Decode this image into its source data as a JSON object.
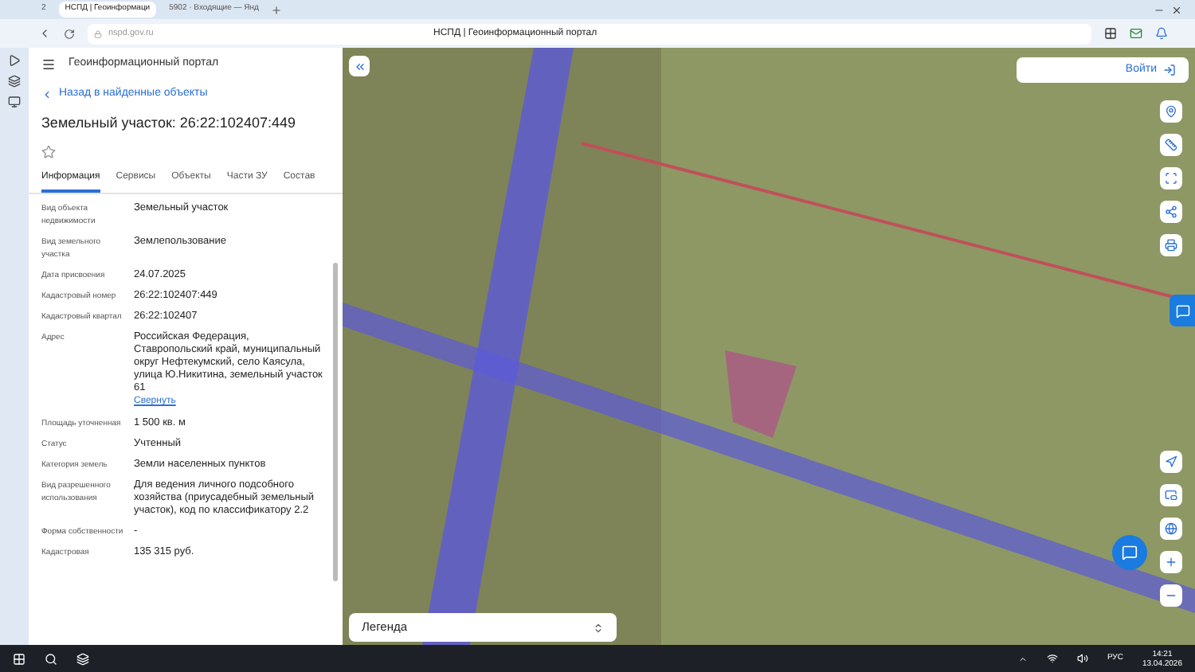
{
  "browser": {
    "tabs": [
      {
        "label": "2",
        "selected": false
      },
      {
        "label": "НСПД | Геоинформаци",
        "selected": true
      },
      {
        "label": "5902 · Входящие — Янд",
        "selected": false
      }
    ],
    "address": "nspd.gov.ru",
    "page_title": "НСПД | Геоинформационный портал"
  },
  "panel": {
    "app_title": "Геоинформационный портал",
    "back_link": "Назад в найденные объекты",
    "title": "Земельный участок: 26:22:102407:449",
    "favorite": false,
    "tabs": [
      {
        "label": "Информация",
        "selected": true
      },
      {
        "label": "Сервисы",
        "selected": false
      },
      {
        "label": "Объекты",
        "selected": false
      },
      {
        "label": "Части ЗУ",
        "selected": false
      },
      {
        "label": "Состав",
        "selected": false
      }
    ],
    "rows": [
      {
        "label": "Вид объекта недвижимости",
        "value": "Земельный участок"
      },
      {
        "label": "Вид земельного участка",
        "value": "Землепользование"
      },
      {
        "label": "Дата присвоения",
        "value": "24.07.2025"
      },
      {
        "label": "Кадастровый номер",
        "value": "26:22:102407:449"
      },
      {
        "label": "Кадастровый квартал",
        "value": "26:22:102407"
      },
      {
        "label": "Адрес",
        "value": "Российская Федерация, Ставропольский край, муниципальный округ Нефтекумский, село Каясула, улица Ю.Никитина, земельный участок 61",
        "link": "Свернуть"
      },
      {
        "label": "Площадь уточненная",
        "value": "1 500 кв. м"
      },
      {
        "label": "Статус",
        "value": "Учтенный"
      },
      {
        "label": "Категория земель",
        "value": "Земли населенных пунктов"
      },
      {
        "label": "Вид разрешенного использования",
        "value": "Для ведения личного подсобного хозяйства (приусадебный земельный участок), код по классификатору 2.2"
      },
      {
        "label": "Форма собственности",
        "value": "-"
      },
      {
        "label": "Кадастровая",
        "value": "135 315 руб."
      }
    ]
  },
  "map": {
    "login": "Войти",
    "legend": "Легенда"
  },
  "taskbar": {
    "lang": "РУС",
    "time": "14:21",
    "date": "13.04.2026"
  }
}
